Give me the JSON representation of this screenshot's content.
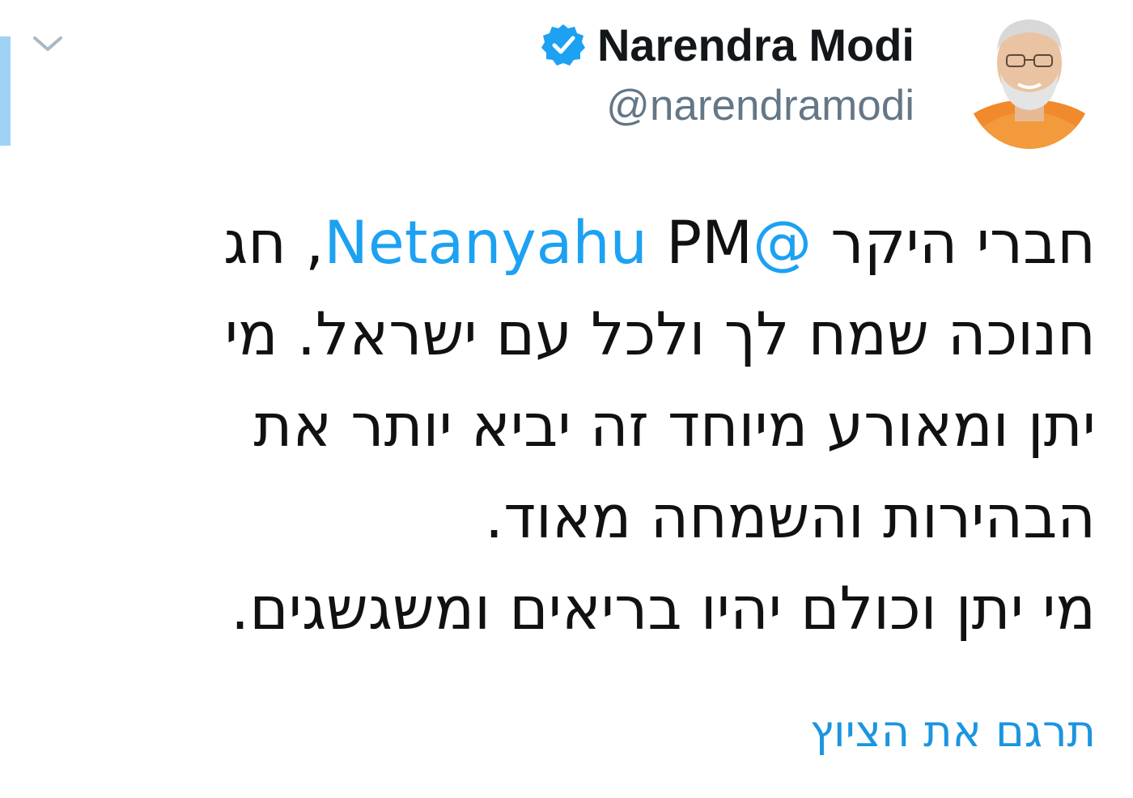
{
  "user": {
    "display_name": "Narendra Modi",
    "handle": "@narendramodi",
    "verified": true
  },
  "tweet": {
    "line1_text_a": "חברי היקר ",
    "line1_mention": "@Netanyahu",
    "line1_text_b": " PM, חג",
    "line2": "חנוכה שמח לך ולכל עם ישראל. מי",
    "line3": "יתן ומאורע מיוחד זה יביא יותר את",
    "line4": "הבהירות והשמחה מאוד.",
    "line5": "מי יתן וכולם יהיו בריאים ומשגשגים."
  },
  "translate_link": "תרגם את הציוץ",
  "icons": {
    "menu": "chevron-down-icon",
    "verified": "verified-badge-icon",
    "avatar": "profile-photo"
  },
  "colors": {
    "mention": "#1da1f2",
    "link": "#1b95e0",
    "handle": "#657786",
    "verified": "#1da1f2",
    "accent_bar": "#9fd3f6"
  }
}
